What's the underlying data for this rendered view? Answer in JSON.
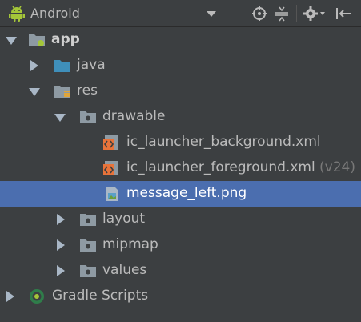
{
  "toolbar": {
    "title": "Android",
    "icons": [
      "android-icon",
      "dropdown-arrow-icon",
      "locate-icon",
      "collapse-all-icon",
      "gear-icon",
      "hide-panel-icon"
    ]
  },
  "tree": {
    "app": "app",
    "java": "java",
    "res": "res",
    "drawable": "drawable",
    "file1": "ic_launcher_background.xml",
    "file2": "ic_launcher_foreground.xml",
    "file2_suffix": "(v24)",
    "file3": "message_left.png",
    "layout": "layout",
    "mipmap": "mipmap",
    "values": "values",
    "gradle": "Gradle Scripts"
  },
  "colors": {
    "background": "#3c3f41",
    "selection": "#4b6eaf",
    "text": "#bbbbbb",
    "android_green": "#a4c639",
    "folder_blue": "#3f8fba",
    "xml_orange": "#e8733a"
  }
}
